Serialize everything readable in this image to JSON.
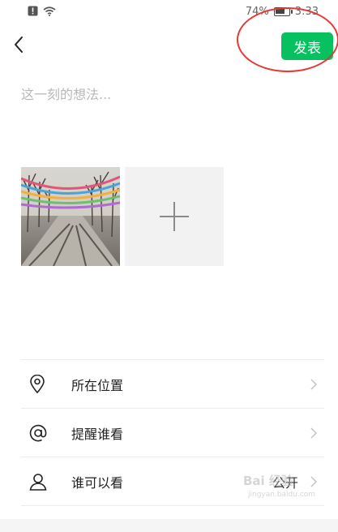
{
  "status_bar": {
    "battery": "74%",
    "time": "3:33",
    "battery_level": 0.74,
    "icons": [
      "alert-icon",
      "wifi-icon",
      "battery-icon"
    ]
  },
  "header": {
    "back_icon": "chevron-left-icon",
    "publish_label": "发表",
    "publish_color": "#07c160",
    "highlight_color": "#e53935"
  },
  "composer": {
    "placeholder": "这一刻的想法..."
  },
  "photos": {
    "add_icon": "plus-icon"
  },
  "options": [
    {
      "label": "所在位置",
      "icon": "location-pin-icon",
      "value": ""
    },
    {
      "label": "提醒谁看",
      "icon": "at-sign-icon",
      "value": ""
    },
    {
      "label": "谁可以看",
      "icon": "person-icon",
      "value": "公开"
    }
  ],
  "watermark": {
    "brand": "Bai 经验",
    "url": "jingyan.baidu.com"
  }
}
